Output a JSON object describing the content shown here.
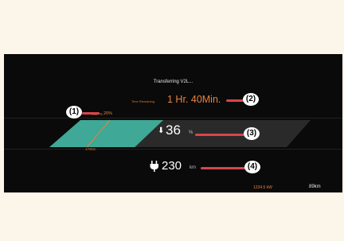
{
  "status": {
    "title": "Transferring V2L..."
  },
  "time_remaining": {
    "label": "Time Remaining",
    "value": "1 Hr. 40Min."
  },
  "min_percent": {
    "label": "Min. %",
    "value": "20%"
  },
  "charge_bar": {
    "min_km": "170km",
    "level_percent": 36
  },
  "state_of_charge": {
    "value": "36",
    "unit": "%",
    "icon": "battery-down-arrow-icon"
  },
  "range": {
    "value": "230",
    "unit": "km",
    "icon": "plug-icon"
  },
  "energy": {
    "value": "1234.5 kW"
  },
  "speed": {
    "value": "89km"
  },
  "callouts": [
    "(1)",
    "(2)",
    "(3)",
    "(4)"
  ],
  "colors": {
    "accent": "#e8823e",
    "bar_fill": "#3fa896",
    "callout_line": "#d8454d",
    "background": "#0a0a0a"
  }
}
